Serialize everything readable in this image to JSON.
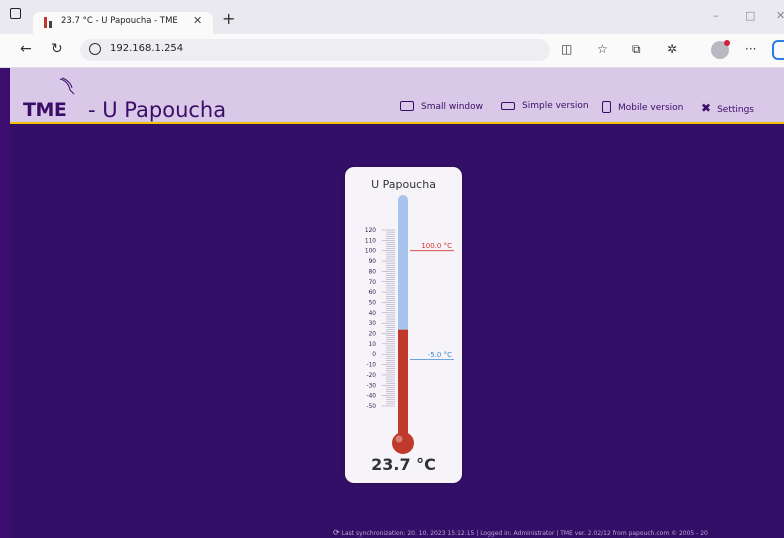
{
  "browser": {
    "tab_title": "23.7 °C - U Papoucha - TME",
    "url": "192.168.1.254",
    "win_min": "–",
    "win_max": "□",
    "win_close": "✕",
    "new_tab": "+",
    "tab_close": "✕",
    "more": "···"
  },
  "header": {
    "logo": "TME",
    "title": "- U Papoucha",
    "menu": [
      {
        "label": "Small window",
        "icon": "window-icon"
      },
      {
        "label": "Simple version",
        "icon": "simple-version-icon"
      },
      {
        "label": "Mobile version",
        "icon": "mobile-icon"
      },
      {
        "label": "Settings",
        "icon": "settings-icon"
      }
    ]
  },
  "thermometer": {
    "name": "U Papoucha",
    "reading": "23.7 °C",
    "value": 23.7,
    "scale_min": -50,
    "scale_max": 120,
    "scale_labels": [
      "120",
      "110",
      "100",
      "90",
      "80",
      "70",
      "60",
      "50",
      "40",
      "30",
      "20",
      "10",
      "0",
      "-10",
      "-20",
      "-30",
      "-40",
      "-50"
    ],
    "high_limit": {
      "label": "100.0 °C",
      "value": 100,
      "color": "#d8342c"
    },
    "low_limit": {
      "label": "-5.0 °C",
      "value": -5,
      "color": "#3b8ad8"
    },
    "mercury_color": "#c0392b",
    "tube_color": "#a9c4ec"
  },
  "footer": {
    "text": "Last synchronization: 20. 10. 2023 15:12:15 | Logged in: Administrator | TME ver. 2.02/12 from papouch.com © 2005 - 20"
  }
}
